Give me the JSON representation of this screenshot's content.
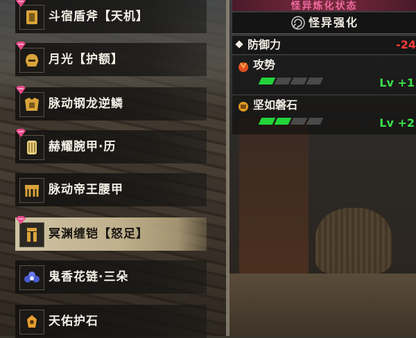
{
  "equipment_list": [
    {
      "label": "斗宿盾斧【天机】",
      "icon": "charge-blade-icon",
      "selected": false
    },
    {
      "label": "月光【护额】",
      "icon": "helmet-icon",
      "selected": false
    },
    {
      "label": "脉动钢龙逆鳞",
      "icon": "chest-armor-icon",
      "selected": false
    },
    {
      "label": "赫耀腕甲·历",
      "icon": "gauntlet-icon",
      "selected": false
    },
    {
      "label": "脉动帝王腰甲",
      "icon": "waist-armor-icon",
      "selected": false
    },
    {
      "label": "冥渊缠铠【怒足】",
      "icon": "leg-armor-icon",
      "selected": true
    },
    {
      "label": "鬼香花链·三朵",
      "icon": "talisman-flower-icon",
      "selected": false
    },
    {
      "label": "天佑护石",
      "icon": "charm-icon",
      "selected": false
    }
  ],
  "panel": {
    "header": "怪异炼化状态",
    "subheader": "怪异强化",
    "stat": {
      "name": "防御力",
      "value": "-24"
    },
    "skills": [
      {
        "name": "攻势",
        "icon": "attack-skill-icon",
        "level_filled": 1,
        "level_total": 4,
        "level_text": "Lv +1"
      },
      {
        "name": "坚如磐石",
        "icon": "guard-skill-icon",
        "level_filled": 2,
        "level_total": 4,
        "level_text": "Lv +2"
      }
    ]
  },
  "colors": {
    "selected_row": "#cfc3a4",
    "header_accent": "#f06aa0",
    "level_green": "#22d43a",
    "negative_red": "#ff3b3b"
  }
}
